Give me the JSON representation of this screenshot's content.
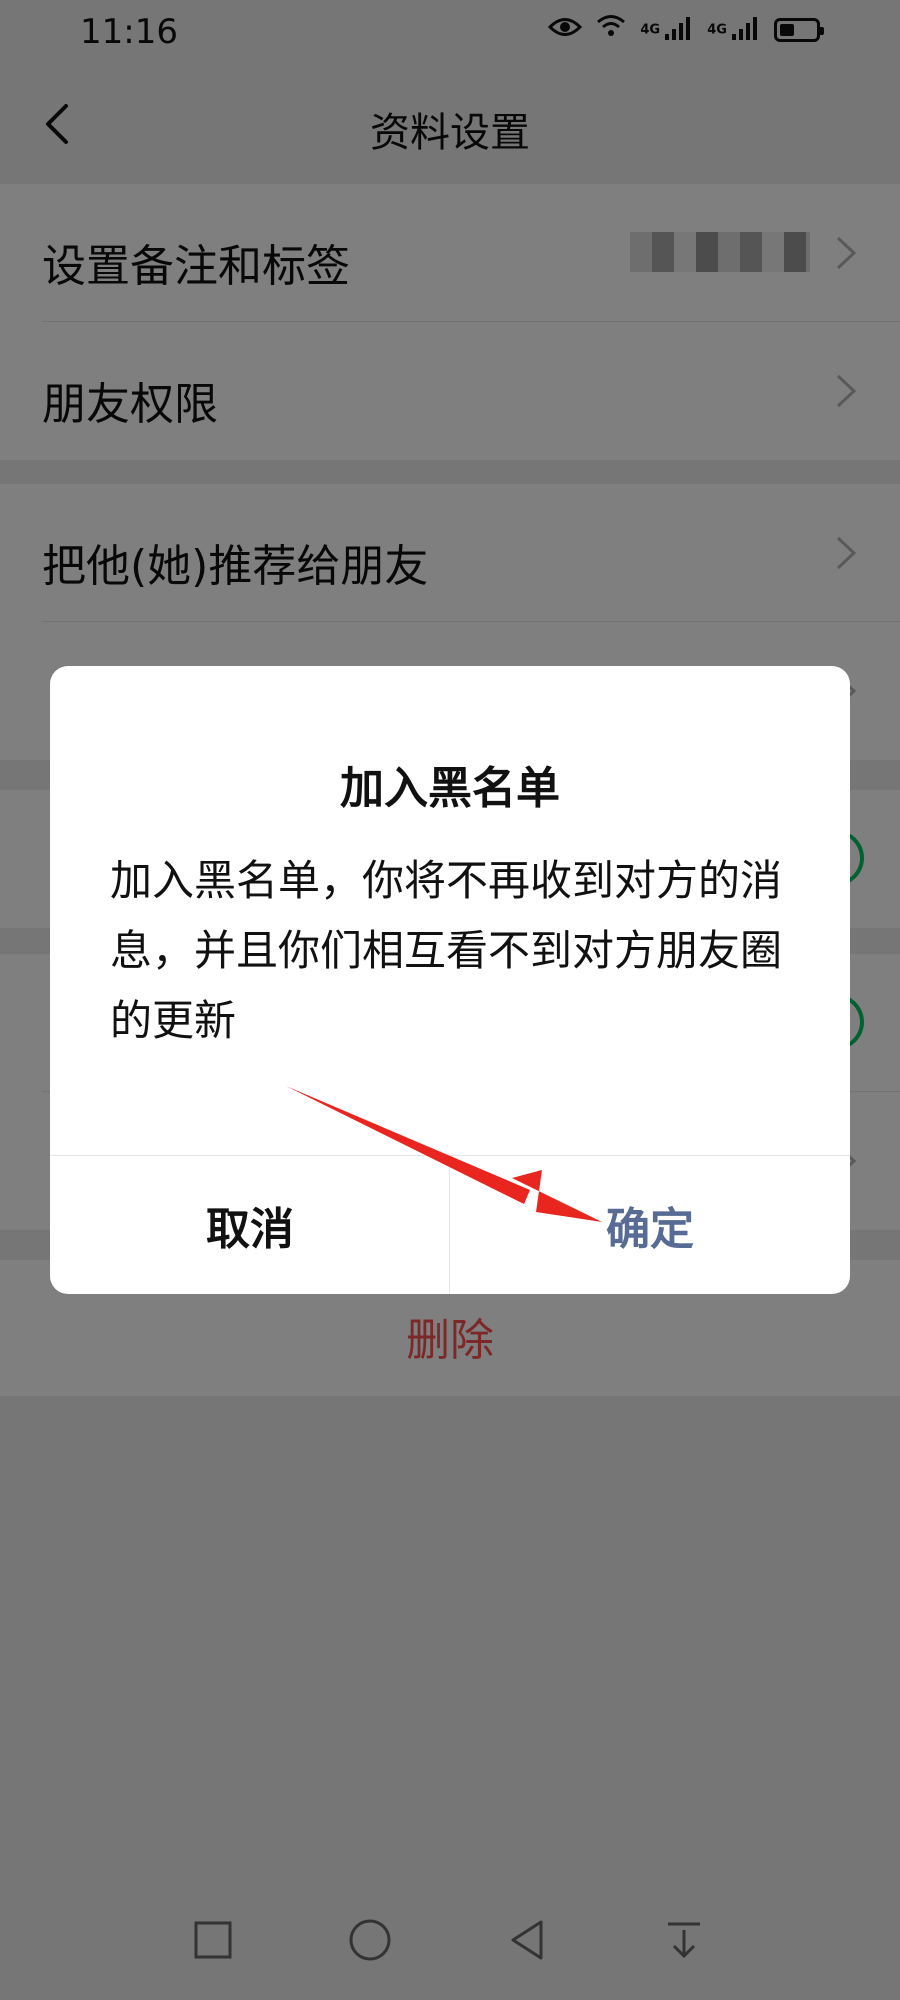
{
  "status_bar": {
    "time": "11:16",
    "net1": "4G",
    "net2": "4G",
    "battery_level_fraction": 0.35
  },
  "nav": {
    "title": "资料设置"
  },
  "settings": {
    "group1": [
      {
        "label": "设置备注和标签"
      },
      {
        "label": "朋友权限"
      }
    ],
    "group2": [
      {
        "label": "把他(她)推荐给朋友"
      }
    ],
    "delete_label": "删除"
  },
  "dialog": {
    "title": "加入黑名单",
    "message": "加入黑名单，你将不再收到对方的消息，并且你们相互看不到对方朋友圈的更新",
    "cancel_label": "取消",
    "confirm_label": "确定"
  },
  "colors": {
    "confirm": "#576b95",
    "delete": "#fa5151",
    "switch_on": "#07c160",
    "annotation": "#e8261f"
  }
}
